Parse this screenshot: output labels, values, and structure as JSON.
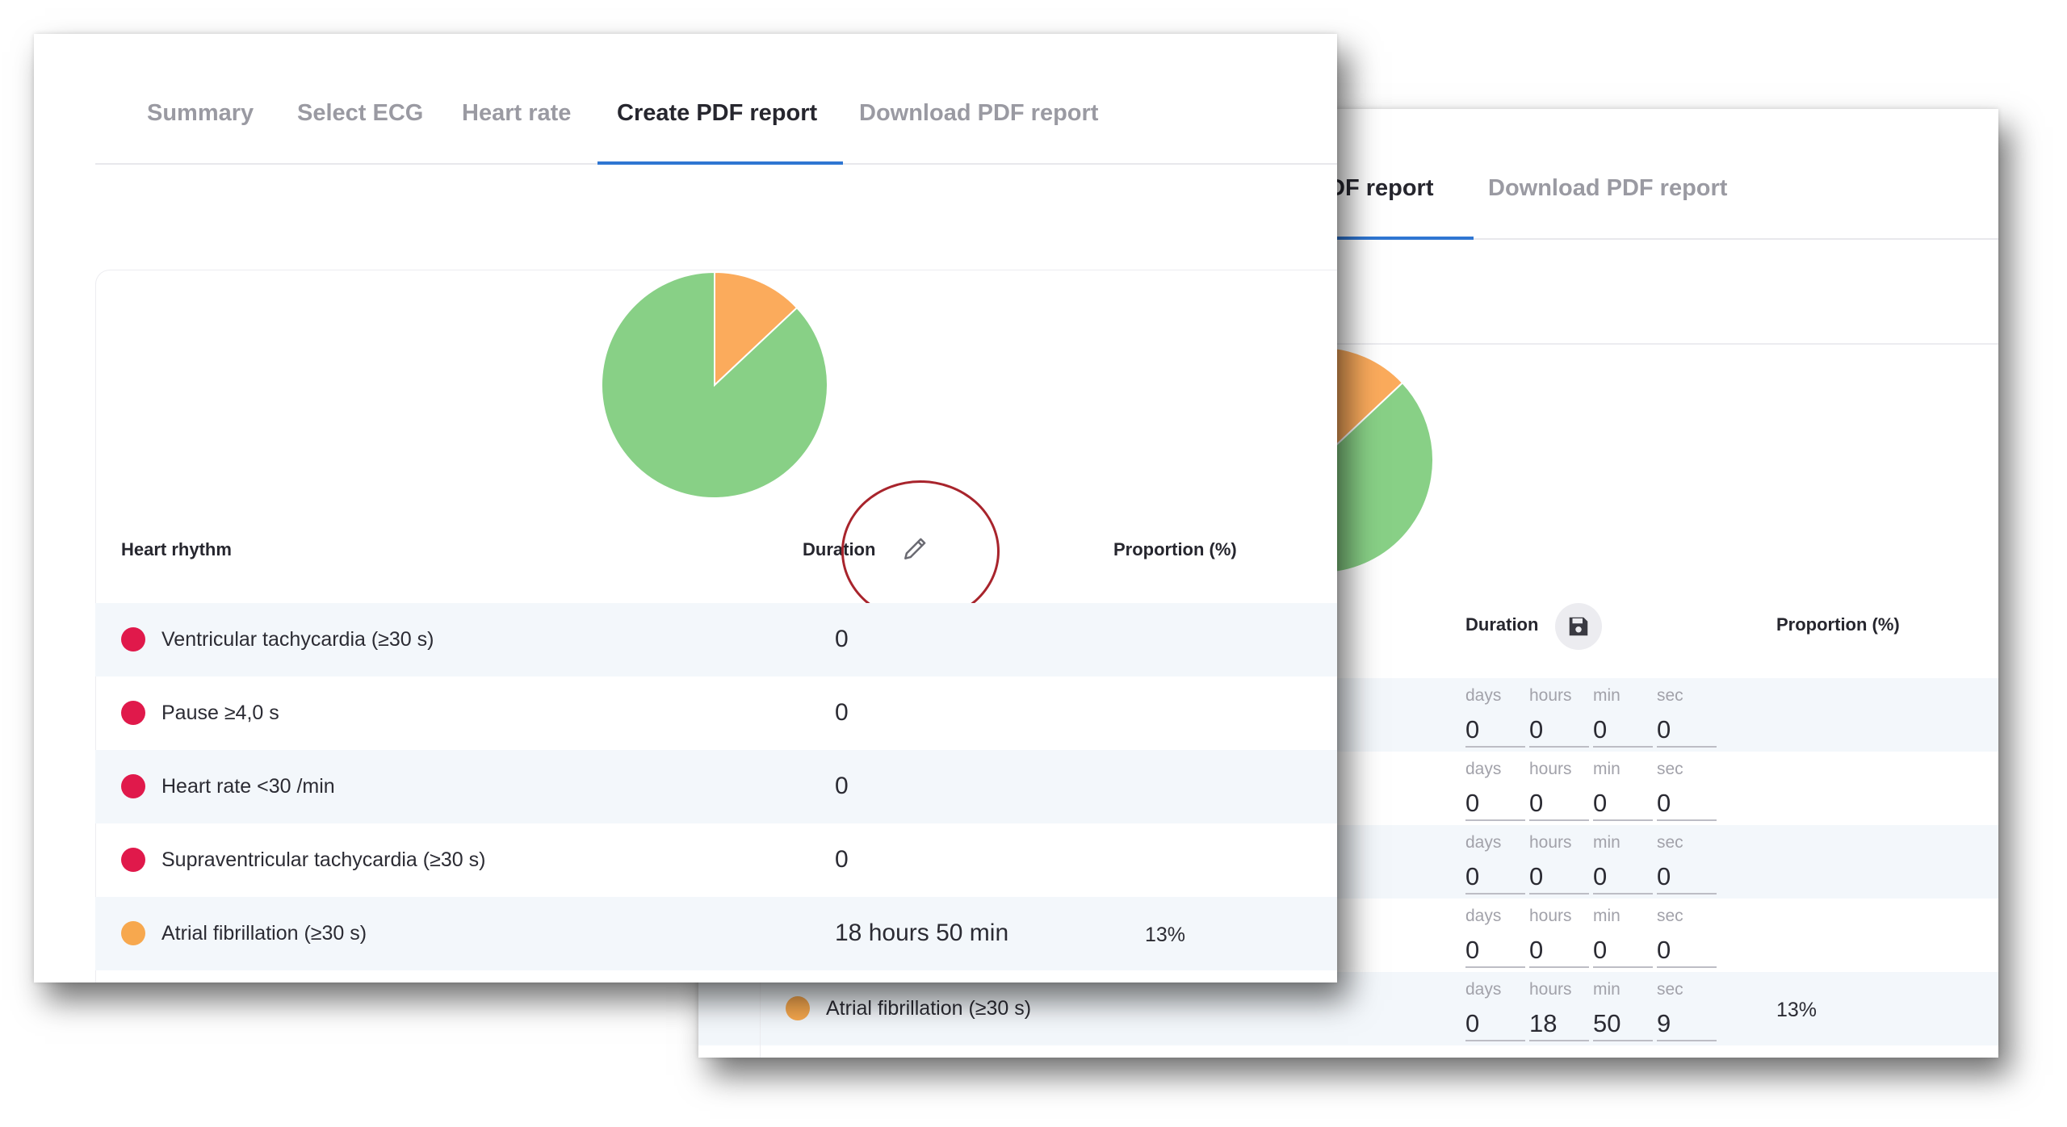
{
  "tabs": {
    "summary": "Summary",
    "select_ecg": "Select ECG",
    "heart_rate": "Heart rate",
    "create_pdf": "Create PDF report",
    "download_pdf": "Download PDF report"
  },
  "back_tabs": {
    "create_pdf_partial": "DF report",
    "download_pdf": "Download PDF report"
  },
  "table": {
    "col_rhythm": "Heart rhythm",
    "col_duration": "Duration",
    "col_proportion": "Proportion (%)"
  },
  "rows": [
    {
      "label": "Ventricular tachycardia (≥30 s)",
      "duration": "0",
      "proportion": "",
      "color": "#e0194b"
    },
    {
      "label": "Pause ≥4,0 s",
      "duration": "0",
      "proportion": "",
      "color": "#e0194b"
    },
    {
      "label": "Heart rate <30 /min",
      "duration": "0",
      "proportion": "",
      "color": "#e0194b"
    },
    {
      "label": "Supraventricular tachycardia (≥30 s)",
      "duration": "0",
      "proportion": "",
      "color": "#e0194b"
    },
    {
      "label": "Atrial fibrillation (≥30 s)",
      "duration": "18 hours 50 min",
      "proportion": "13%",
      "color": "#f7a84e"
    }
  ],
  "back_rows": [
    {
      "days": "0",
      "hours": "0",
      "min": "0",
      "sec": "0",
      "proportion": ""
    },
    {
      "days": "0",
      "hours": "0",
      "min": "0",
      "sec": "0",
      "proportion": ""
    },
    {
      "days": "0",
      "hours": "0",
      "min": "0",
      "sec": "0",
      "proportion": ""
    },
    {
      "days": "0",
      "hours": "0",
      "min": "0",
      "sec": "0",
      "proportion": ""
    },
    {
      "days": "0",
      "hours": "18",
      "min": "50",
      "sec": "9",
      "proportion": "13%",
      "label": "Atrial fibrillation (≥30 s)"
    }
  ],
  "units": {
    "days": "days",
    "hours": "hours",
    "min": "min",
    "sec": "sec"
  },
  "colors": {
    "pie_main": "#88d086",
    "pie_af": "#fbab5c",
    "accent": "#2f76d2",
    "annotation": "#a8242c"
  },
  "icons": {
    "edit": "pencil-icon",
    "save": "floppy-disk-icon"
  },
  "chart_data": {
    "type": "pie",
    "slices": [
      {
        "label": "Atrial fibrillation (≥30 s)",
        "value": 13,
        "color": "#fbab5c"
      },
      {
        "label": "",
        "value": 87,
        "color": "#88d086"
      }
    ]
  }
}
